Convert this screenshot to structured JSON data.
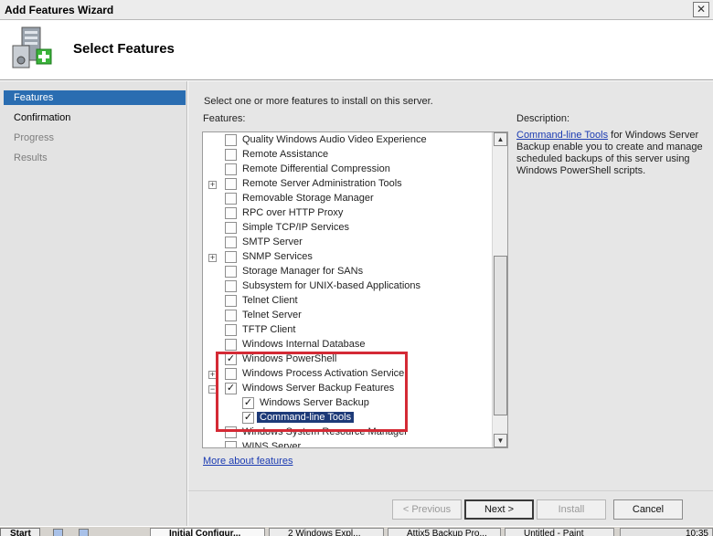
{
  "window": {
    "title": "Add Features Wizard",
    "close_glyph": "✕"
  },
  "header": {
    "heading": "Select Features",
    "icon": "server-add-icon"
  },
  "steps": [
    {
      "label": "Features",
      "state": "active"
    },
    {
      "label": "Confirmation",
      "state": "done"
    },
    {
      "label": "Progress",
      "state": "pending"
    },
    {
      "label": "Results",
      "state": "pending"
    }
  ],
  "main": {
    "instruction": "Select one or more features to install on this server.",
    "features_label": "Features:",
    "more_link": "More about features"
  },
  "features": [
    {
      "label": "Quality Windows Audio Video Experience",
      "checked": false,
      "expander": "",
      "indent": 0
    },
    {
      "label": "Remote Assistance",
      "checked": false,
      "expander": "",
      "indent": 0
    },
    {
      "label": "Remote Differential Compression",
      "checked": false,
      "expander": "",
      "indent": 0
    },
    {
      "label": "Remote Server Administration Tools",
      "checked": false,
      "expander": "+",
      "indent": 0
    },
    {
      "label": "Removable Storage Manager",
      "checked": false,
      "expander": "",
      "indent": 0
    },
    {
      "label": "RPC over HTTP Proxy",
      "checked": false,
      "expander": "",
      "indent": 0
    },
    {
      "label": "Simple TCP/IP Services",
      "checked": false,
      "expander": "",
      "indent": 0
    },
    {
      "label": "SMTP Server",
      "checked": false,
      "expander": "",
      "indent": 0
    },
    {
      "label": "SNMP Services",
      "checked": false,
      "expander": "+",
      "indent": 0
    },
    {
      "label": "Storage Manager for SANs",
      "checked": false,
      "expander": "",
      "indent": 0
    },
    {
      "label": "Subsystem for UNIX-based Applications",
      "checked": false,
      "expander": "",
      "indent": 0
    },
    {
      "label": "Telnet Client",
      "checked": false,
      "expander": "",
      "indent": 0
    },
    {
      "label": "Telnet Server",
      "checked": false,
      "expander": "",
      "indent": 0
    },
    {
      "label": "TFTP Client",
      "checked": false,
      "expander": "",
      "indent": 0
    },
    {
      "label": "Windows Internal Database",
      "checked": false,
      "expander": "",
      "indent": 0
    },
    {
      "label": "Windows PowerShell",
      "checked": true,
      "expander": "",
      "indent": 0
    },
    {
      "label": "Windows Process Activation Service",
      "checked": false,
      "expander": "+",
      "indent": 0
    },
    {
      "label": "Windows Server Backup Features",
      "checked": true,
      "expander": "−",
      "indent": 0
    },
    {
      "label": "Windows Server Backup",
      "checked": true,
      "expander": "",
      "indent": 1
    },
    {
      "label": "Command-line Tools",
      "checked": true,
      "expander": "",
      "indent": 1,
      "selected": true
    },
    {
      "label": "Windows System Resource Manager",
      "checked": false,
      "expander": "",
      "indent": 0
    },
    {
      "label": "WINS Server",
      "checked": false,
      "expander": "",
      "indent": 0
    }
  ],
  "description": {
    "label": "Description:",
    "link": "Command-line Tools",
    "text": " for Windows Server Backup enable you to create and manage scheduled backups of this server using Windows PowerShell scripts."
  },
  "buttons": {
    "previous": "< Previous",
    "next": "Next >",
    "install": "Install",
    "cancel": "Cancel"
  },
  "taskbar": {
    "start": "Start",
    "tasks": [
      "Initial Configur...",
      "2 Windows Expl...",
      "Attix5 Backup Pro...",
      "Untitled - Paint"
    ],
    "clock": "10:35"
  },
  "colors": {
    "selection": "#2a6db1",
    "highlight_box": "#d42a35",
    "link": "#1b3bb2"
  }
}
